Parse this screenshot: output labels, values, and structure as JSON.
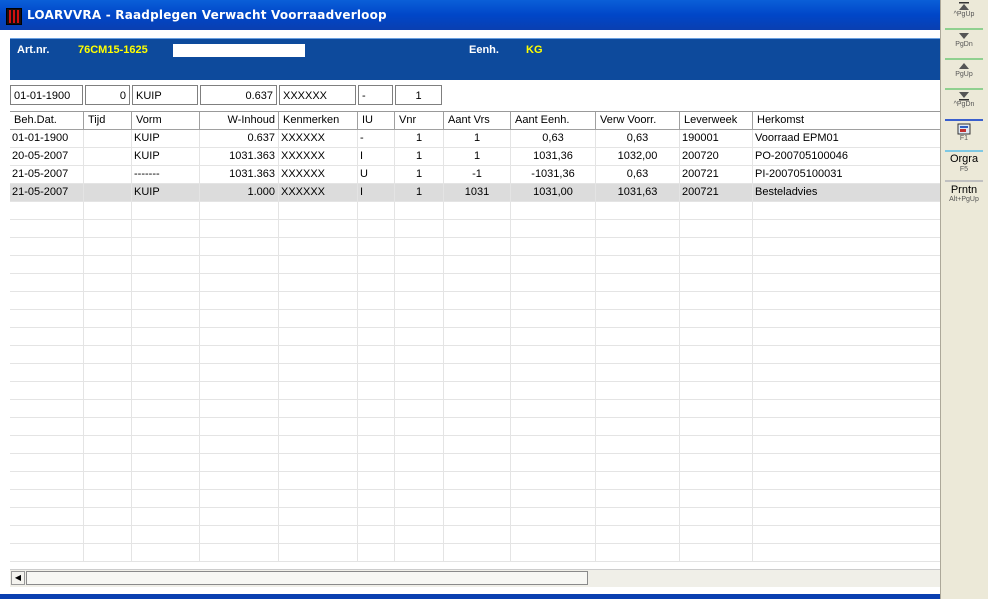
{
  "window": {
    "title": "LOARVVRA - Raadplegen Verwacht Voorraadverloop"
  },
  "header": {
    "art_label": "Art.nr.",
    "art_value": "76CM15-1625",
    "eenh_label": "Eenh.",
    "eenh_value": "KG"
  },
  "filter": {
    "date": "01-01-1900",
    "tijd": "0",
    "vorm": "KUIP",
    "inhoud": "0.637",
    "kenmerken": "XXXXXX",
    "iu": "-",
    "vnr": "1"
  },
  "columns": [
    "Beh.Dat.",
    "Tijd",
    "Vorm",
    "W-Inhoud",
    "Kenmerken",
    "IU",
    "Vnr",
    "Aant Vrs",
    "Aant Eenh.",
    "Verw Voorr.",
    "Leverweek",
    "Herkomst"
  ],
  "rows": [
    [
      "01-01-1900",
      "",
      "KUIP",
      "0.637",
      "XXXXXX",
      "-",
      "1",
      "1",
      "0,63",
      "0,63",
      "190001",
      "Voorraad EPM01"
    ],
    [
      "20-05-2007",
      "",
      "KUIP",
      "1031.363",
      "XXXXXX",
      "I",
      "1",
      "1",
      "1031,36",
      "1032,00",
      "200720",
      "PO-200705100046"
    ],
    [
      "21-05-2007",
      "",
      "-------",
      "1031.363",
      "XXXXXX",
      "U",
      "1",
      "-1",
      "-1031,36",
      "0,63",
      "200721",
      "PI-200705100031"
    ],
    [
      "21-05-2007",
      "",
      "KUIP",
      "1.000",
      "XXXXXX",
      "I",
      "1",
      "1031",
      "1031,00",
      "1031,63",
      "200721",
      "Besteladvies"
    ]
  ],
  "selected_row": 3,
  "sidebar": {
    "btn1_sub": "^PgUp",
    "btn2_sub": "PgDn",
    "btn3_sub": "PgUp",
    "btn4_sub": "^PgDn",
    "btn5_sub": "F1",
    "btn6_label": "Orgra",
    "btn6_sub": "F5",
    "btn7_label": "Prntn",
    "btn7_sub": "Alt+PgUp"
  },
  "colors": {
    "title_bar": "#0046c8",
    "header_panel": "#0d4a9c",
    "header_value": "#ffff00",
    "selected_row": "#dcdcdc"
  }
}
